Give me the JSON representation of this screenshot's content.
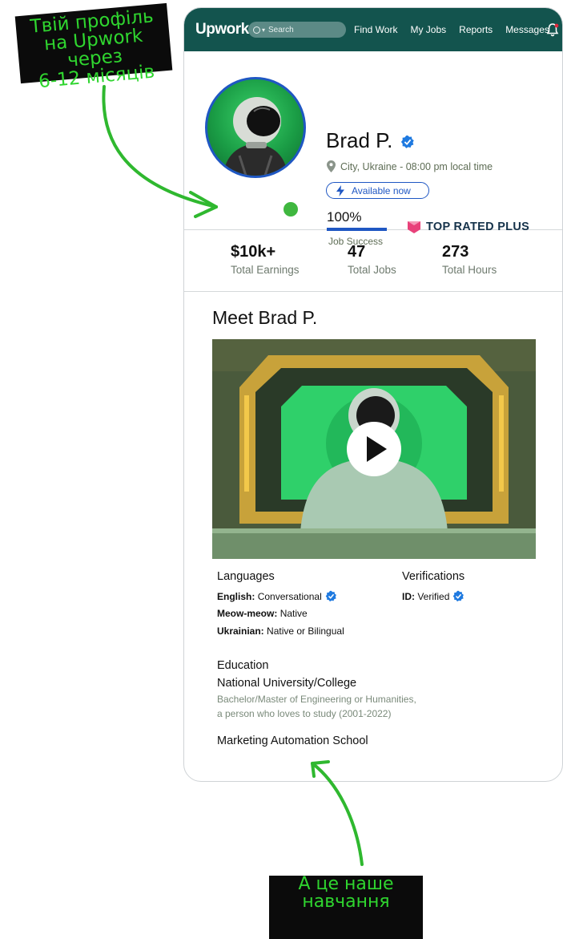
{
  "annotations": {
    "top_note": "Твій профіль\nна Upwork через\n6-12 місяців",
    "bottom_note": "А це наше\nнавчання"
  },
  "topbar": {
    "logo": "Upwork",
    "search_placeholder": "Search",
    "nav": [
      "Find Work",
      "My Jobs",
      "Reports",
      "Messages"
    ]
  },
  "profile": {
    "name": "Brad P.",
    "location": "City, Ukraine - 08:00 pm local time",
    "availability": "Available now",
    "job_success_value": "100%",
    "job_success_label": "Job Success",
    "badge": "TOP RATED PLUS"
  },
  "stats": [
    {
      "value": "$10k+",
      "label": "Total Earnings"
    },
    {
      "value": "47",
      "label": "Total Jobs"
    },
    {
      "value": "273",
      "label": "Total Hours"
    }
  ],
  "about": {
    "title": "Meet Brad P.",
    "languages_heading": "Languages",
    "languages": [
      {
        "name": "English:",
        "level": "Conversational",
        "verified": true
      },
      {
        "name": "Meow-meow:",
        "level": "Native",
        "verified": false
      },
      {
        "name": "Ukrainian:",
        "level": "Native or Bilingual",
        "verified": false
      }
    ],
    "verifications_heading": "Verifications",
    "verification": {
      "name": "ID:",
      "status": "Verified"
    },
    "education_heading": "Education",
    "education": [
      {
        "school": "National University/College",
        "line1": "Bachelor/Master of Engineering or Humanities,",
        "line2": "a person who loves to study (2001-2022)"
      },
      {
        "school": "Marketing Automation School"
      }
    ]
  },
  "colors": {
    "topbar": "#13544e",
    "accent_blue": "#1f57c3",
    "annotation_green": "#2fd52f",
    "top_rated_pink": "#e8417a"
  }
}
